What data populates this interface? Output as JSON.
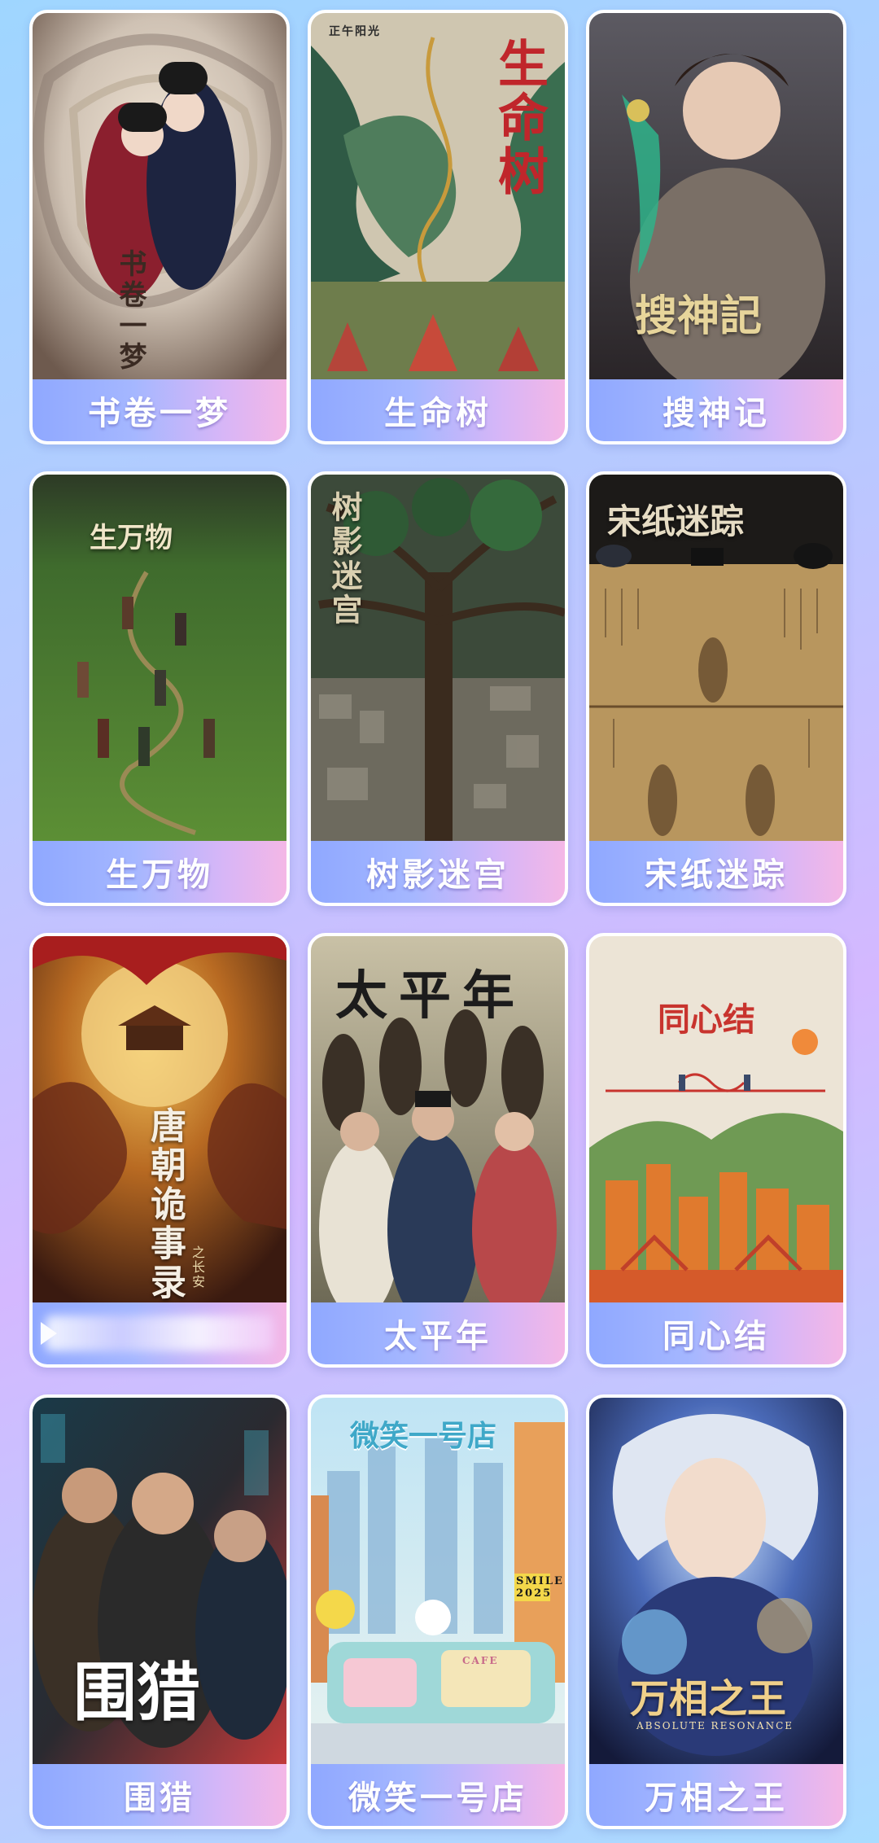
{
  "shows": [
    {
      "label": "书卷一梦",
      "poster_title": "书卷一梦"
    },
    {
      "label": "生命树",
      "poster_title": "生命树",
      "poster_badge": "正午阳光"
    },
    {
      "label": "搜神记",
      "poster_title": "搜神記"
    },
    {
      "label": "生万物",
      "poster_title": "生万物"
    },
    {
      "label": "树影迷宫",
      "poster_title": "树影迷宫"
    },
    {
      "label": "宋纸迷踪",
      "poster_title": "宋纸迷踪"
    },
    {
      "label": "",
      "poster_title": "唐朝诡事录",
      "poster_sub": "之长安",
      "label_obscured": true
    },
    {
      "label": "太平年",
      "poster_title": "太平年"
    },
    {
      "label": "同心结",
      "poster_title": "同心结"
    },
    {
      "label": "围猎",
      "poster_title": "围猎"
    },
    {
      "label": "微笑一号店",
      "poster_title": "微笑一号店",
      "poster_badge": "SMILE 2025",
      "poster_sign": "CAFE"
    },
    {
      "label": "万相之王",
      "poster_title": "万相之王",
      "poster_sub": "ABSOLUTE RESONANCE"
    }
  ],
  "colors": {
    "label_gradient_start": "#8fa8ff",
    "label_gradient_end": "#f4b7e6",
    "background": "#b9c8ff"
  }
}
